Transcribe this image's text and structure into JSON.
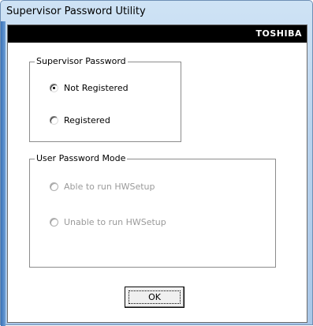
{
  "window": {
    "title": "Supervisor Password Utility"
  },
  "brand": {
    "name": "TOSHIBA"
  },
  "supervisor_group": {
    "label": "Supervisor Password",
    "options": [
      {
        "label": "Not Registered",
        "checked": true,
        "enabled": true
      },
      {
        "label": "Registered",
        "checked": false,
        "enabled": true
      }
    ]
  },
  "user_mode_group": {
    "label": "User Password Mode",
    "enabled": false,
    "options": [
      {
        "label": "Able to run HWSetup",
        "checked": false,
        "enabled": false
      },
      {
        "label": "Unable to run HWSetup",
        "checked": false,
        "enabled": false
      }
    ]
  },
  "buttons": {
    "ok_label": "OK"
  },
  "colors": {
    "brand_bar": "#000000",
    "brand_text": "#ffffff",
    "disabled_text": "#9a9a9a",
    "titlebar": "#b9d3ee"
  }
}
